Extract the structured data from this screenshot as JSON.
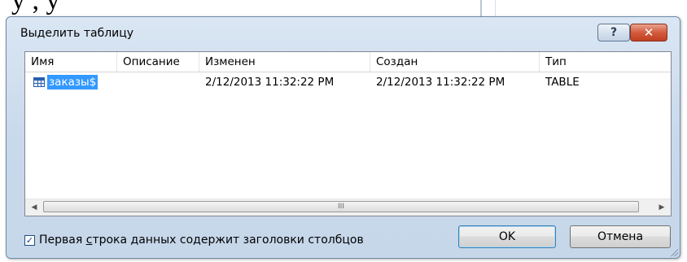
{
  "background": {
    "text": "у            ,           у"
  },
  "dialog": {
    "title": "Выделить таблицу",
    "help_glyph": "?",
    "close_glyph": "✕"
  },
  "list": {
    "columns": [
      "Имя",
      "Описание",
      "Изменен",
      "Создан",
      "Тип"
    ],
    "rows": [
      {
        "name": "заказы$",
        "description": "",
        "modified": "2/12/2013 11:32:22 PM",
        "created": "2/12/2013 11:32:22 PM",
        "type": "TABLE"
      }
    ],
    "scroll_left_glyph": "◀",
    "scroll_right_glyph": "▶",
    "scroll_grip": "III"
  },
  "footer": {
    "checkbox_checked": true,
    "checkbox_label_before": "Первая ",
    "checkbox_label_underlined": "с",
    "checkbox_label_after": "трока данных содержит заголовки столбцов",
    "ok_label": "OK",
    "cancel_label": "Отмена"
  },
  "icons": {
    "table": "table-icon",
    "help": "help-icon",
    "close": "close-icon",
    "check": "checkmark-icon"
  },
  "colors": {
    "selection": "#3399ff",
    "close_button": "#c0401f",
    "dialog_frame": "#c9d9ec"
  }
}
